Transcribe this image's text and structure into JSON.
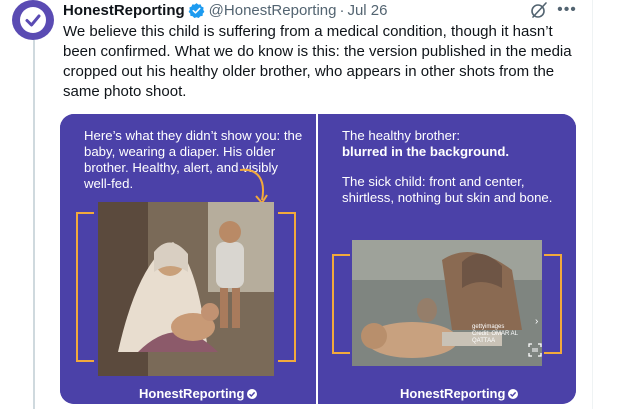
{
  "tweet": {
    "author": {
      "display_name": "HonestReporting",
      "handle": "@HonestReporting",
      "verified": true
    },
    "separator": "·",
    "date": "Jul 26",
    "text": "We believe this child is suffering from a medical condition, though it hasn’t been confirmed. What we do know is this: the version published in the media cropped out his healthy older brother, who appears in other shots from the same photo shoot."
  },
  "icons": {
    "avatar": "honestreporting-logo-icon",
    "verified": "verified-badge-icon",
    "grok": "grok-icon",
    "more": "more-icon"
  },
  "media": {
    "left": {
      "caption": "Here’s what they didn’t show you: the baby, wearing a diaper. His older brother. Healthy, alert, and visibly well-fed.",
      "logo": "HonestReporting"
    },
    "right": {
      "caption_line1": "The healthy brother:",
      "caption_bold": "blurred in the background.",
      "caption_b": "The sick child: front and center, shirtless, nothing but skin and bone.",
      "watermark": "gettyimages",
      "watermark_credit": "Credit: OMAR AL QATTAA",
      "logo": "HonestReporting"
    }
  },
  "colors": {
    "panel_bg": "#4b41a8",
    "bracket": "#f2a93b",
    "verified": "#1d9bf0",
    "text_secondary": "#536471"
  }
}
